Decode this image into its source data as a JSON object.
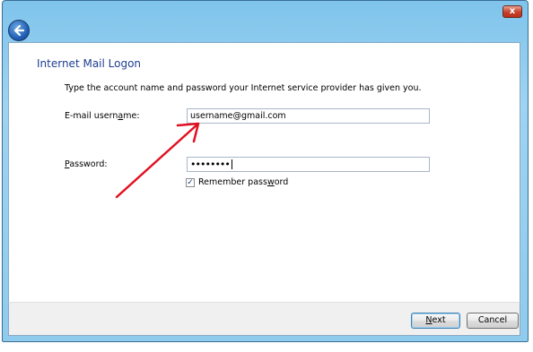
{
  "window": {
    "close_glyph": "x",
    "back_icon": "back-arrow-icon"
  },
  "page": {
    "title": "Internet Mail Logon",
    "intro": "Type the account name and password your Internet service provider has given you."
  },
  "fields": {
    "username": {
      "label_pre": "E-mail usern",
      "label_accel": "a",
      "label_post": "me:",
      "value": "username@gmail.com"
    },
    "password": {
      "label_pre": "",
      "label_accel": "P",
      "label_post": "assword:",
      "masked_value": "••••••••"
    }
  },
  "remember": {
    "checked": true,
    "label_pre": "Remember pass",
    "label_accel": "w",
    "label_post": "ord"
  },
  "footer": {
    "next_pre": "",
    "next_accel": "N",
    "next_post": "ext",
    "cancel": "Cancel"
  },
  "annotation": {
    "arrow_color": "#e01020"
  }
}
